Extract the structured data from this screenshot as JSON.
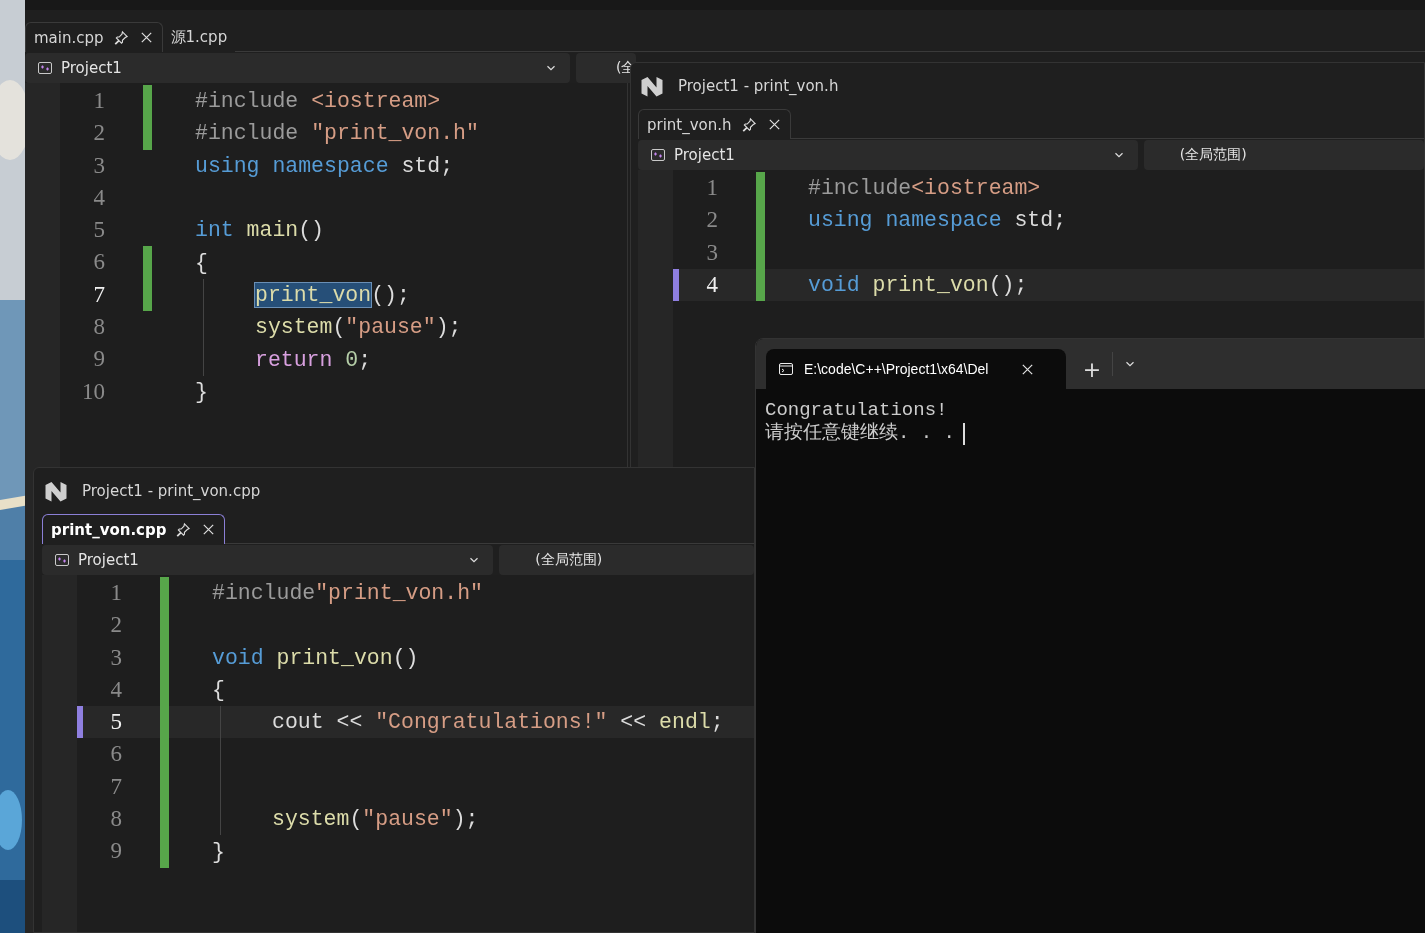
{
  "editors": [
    {
      "tabs": [
        {
          "label": "main.cpp",
          "selected": true
        },
        {
          "label": "源1.cpp",
          "selected": false
        }
      ],
      "project": "Project1",
      "scope": "(全",
      "line_highlight": false,
      "focused": false,
      "lines": [
        {
          "number": "1",
          "changed": true,
          "current": false,
          "indented": false,
          "tokens": [
            {
              "kind": "preproc",
              "text": "#include "
            },
            {
              "kind": "string",
              "text": "<iostream>"
            }
          ]
        },
        {
          "number": "2",
          "changed": true,
          "current": false,
          "indented": false,
          "tokens": [
            {
              "kind": "preproc",
              "text": "#include "
            },
            {
              "kind": "string",
              "text": "\"print_von.h\""
            }
          ]
        },
        {
          "number": "3",
          "changed": false,
          "current": false,
          "indented": false,
          "tokens": [
            {
              "kind": "keyword",
              "text": "using namespace"
            },
            {
              "kind": "plain",
              "text": " std;"
            }
          ]
        },
        {
          "number": "4",
          "changed": false,
          "current": false,
          "indented": false
        },
        {
          "number": "5",
          "changed": false,
          "current": false,
          "indented": false,
          "tokens": [
            {
              "kind": "keyword",
              "text": "int "
            },
            {
              "kind": "func",
              "text": "main"
            },
            {
              "kind": "plain",
              "text": "()"
            }
          ]
        },
        {
          "number": "6",
          "changed": true,
          "current": false,
          "indented": false,
          "tokens": [
            {
              "kind": "plain",
              "text": "{"
            }
          ]
        },
        {
          "number": "7",
          "changed": true,
          "current": true,
          "indented": true,
          "tokens": [
            {
              "kind": "func",
              "text": "print_von",
              "selected": true
            },
            {
              "kind": "plain",
              "text": "();"
            }
          ]
        },
        {
          "number": "8",
          "changed": false,
          "current": false,
          "indented": true,
          "tokens": [
            {
              "kind": "func",
              "text": "system"
            },
            {
              "kind": "plain",
              "text": "("
            },
            {
              "kind": "string",
              "text": "\"pause\""
            },
            {
              "kind": "plain",
              "text": ");"
            }
          ]
        },
        {
          "number": "9",
          "changed": false,
          "current": false,
          "indented": true,
          "tokens": [
            {
              "kind": "control",
              "text": "return "
            },
            {
              "kind": "number",
              "text": "0"
            },
            {
              "kind": "plain",
              "text": ";"
            }
          ]
        },
        {
          "number": "10",
          "changed": false,
          "current": false,
          "indented": false,
          "tokens": [
            {
              "kind": "plain",
              "text": "}"
            }
          ]
        }
      ]
    },
    {
      "title": "Project1 - print_von.h",
      "tabs": [
        {
          "label": "print_von.h",
          "selected": true
        }
      ],
      "project": "Project1",
      "scope": "(全局范围)",
      "line_highlight": true,
      "focused": false,
      "lines": [
        {
          "number": "1",
          "changed": true,
          "current": false,
          "indented": false,
          "tokens": [
            {
              "kind": "preproc",
              "text": "#include"
            },
            {
              "kind": "string",
              "text": "<iostream>"
            }
          ]
        },
        {
          "number": "2",
          "changed": true,
          "current": false,
          "indented": false,
          "tokens": [
            {
              "kind": "keyword",
              "text": "using namespace"
            },
            {
              "kind": "plain",
              "text": " std;"
            }
          ]
        },
        {
          "number": "3",
          "changed": true,
          "current": false,
          "indented": false
        },
        {
          "number": "4",
          "changed": true,
          "current": true,
          "indented": false,
          "tokens": [
            {
              "kind": "keyword",
              "text": "void "
            },
            {
              "kind": "func",
              "text": "print_von"
            },
            {
              "kind": "plain",
              "text": "();"
            }
          ]
        }
      ]
    },
    {
      "title": "Project1 - print_von.cpp",
      "tabs": [
        {
          "label": "print_von.cpp",
          "selected": true
        }
      ],
      "project": "Project1",
      "scope": "(全局范围)",
      "line_highlight": true,
      "focused": true,
      "lines": [
        {
          "number": "1",
          "changed": true,
          "current": false,
          "indented": false,
          "tokens": [
            {
              "kind": "preproc",
              "text": "#include"
            },
            {
              "kind": "string",
              "text": "\"print_von.h\""
            }
          ]
        },
        {
          "number": "2",
          "changed": true,
          "current": false,
          "indented": false
        },
        {
          "number": "3",
          "changed": true,
          "current": false,
          "indented": false,
          "tokens": [
            {
              "kind": "keyword",
              "text": "void "
            },
            {
              "kind": "func",
              "text": "print_von"
            },
            {
              "kind": "plain",
              "text": "()"
            }
          ]
        },
        {
          "number": "4",
          "changed": true,
          "current": false,
          "indented": false,
          "tokens": [
            {
              "kind": "plain",
              "text": "{"
            }
          ]
        },
        {
          "number": "5",
          "changed": true,
          "current": true,
          "indented": true,
          "tokens": [
            {
              "kind": "plain",
              "text": "cout << "
            },
            {
              "kind": "string",
              "text": "\"Congratulations!\""
            },
            {
              "kind": "plain",
              "text": " << "
            },
            {
              "kind": "func",
              "text": "endl"
            },
            {
              "kind": "plain",
              "text": ";"
            }
          ]
        },
        {
          "number": "6",
          "changed": true,
          "current": false,
          "indented": true
        },
        {
          "number": "7",
          "changed": true,
          "current": false,
          "indented": true
        },
        {
          "number": "8",
          "changed": true,
          "current": false,
          "indented": true,
          "tokens": [
            {
              "kind": "func",
              "text": "system"
            },
            {
              "kind": "plain",
              "text": "("
            },
            {
              "kind": "string",
              "text": "\"pause\""
            },
            {
              "kind": "plain",
              "text": ");"
            }
          ]
        },
        {
          "number": "9",
          "changed": true,
          "current": false,
          "indented": false,
          "tokens": [
            {
              "kind": "plain",
              "text": "}"
            }
          ]
        }
      ]
    }
  ],
  "terminal": {
    "tab_title": "E:\\code\\C++\\Project1\\x64\\Del",
    "new_tab": "+",
    "output": [
      "Congratulations!",
      "请按任意键继续. . ."
    ]
  }
}
